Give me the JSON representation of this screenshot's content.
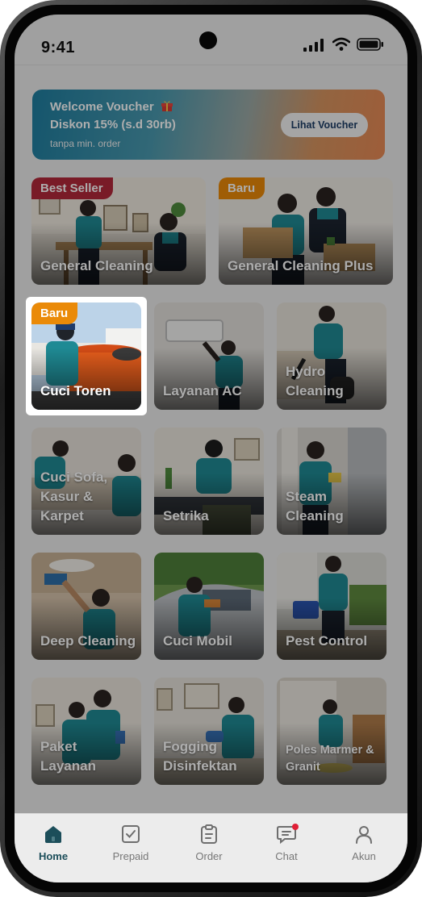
{
  "status_bar": {
    "time": "9:41"
  },
  "voucher": {
    "title": "Welcome Voucher",
    "discount": "Diskon 15% (s.d 30rb)",
    "min_order": "tanpa min. order",
    "button_label": "Lihat Voucher"
  },
  "services": [
    {
      "label": "General Cleaning",
      "badge": "Best Seller",
      "badge_color": "#b3283a"
    },
    {
      "label": "General Cleaning Plus",
      "badge": "Baru",
      "badge_color": "#ea8a08"
    },
    {
      "label": "Cuci Toren",
      "badge": "Baru",
      "badge_color": "#ea8a08",
      "highlighted": true
    },
    {
      "label": "Layanan AC"
    },
    {
      "label": "Hydro Cleaning"
    },
    {
      "label": "Cuci Sofa, Kasur & Karpet"
    },
    {
      "label": "Setrika"
    },
    {
      "label": "Steam Cleaning"
    },
    {
      "label": "Deep Cleaning"
    },
    {
      "label": "Cuci Mobil"
    },
    {
      "label": "Pest Control"
    },
    {
      "label": "Paket Layanan"
    },
    {
      "label": "Fogging Disinfektan"
    },
    {
      "label": "Poles Marmer & Granit"
    }
  ],
  "tabbar": {
    "items": [
      {
        "label": "Home",
        "icon": "home-icon",
        "active": true
      },
      {
        "label": "Prepaid",
        "icon": "prepaid-icon"
      },
      {
        "label": "Order",
        "icon": "order-icon"
      },
      {
        "label": "Chat",
        "icon": "chat-icon",
        "notification": true
      },
      {
        "label": "Akun",
        "icon": "account-icon"
      }
    ]
  },
  "colors": {
    "accent": "#1c4e5a",
    "best_seller": "#b3283a",
    "new_badge": "#ea8a08",
    "notification": "#e01f36"
  }
}
